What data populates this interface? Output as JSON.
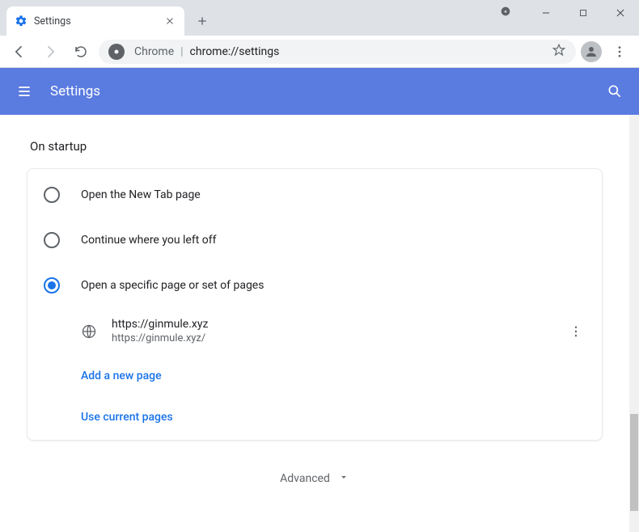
{
  "window": {
    "tab_title": "Settings",
    "url_prefix": "Chrome",
    "url_path": "chrome://settings"
  },
  "header": {
    "title": "Settings"
  },
  "startup": {
    "section_title": "On startup",
    "options": [
      {
        "label": "Open the New Tab page",
        "selected": false
      },
      {
        "label": "Continue where you left off",
        "selected": false
      },
      {
        "label": "Open a specific page or set of pages",
        "selected": true
      }
    ],
    "pages": [
      {
        "title": "https://ginmule.xyz",
        "url": "https://ginmule.xyz/"
      }
    ],
    "add_page_label": "Add a new page",
    "use_current_label": "Use current pages"
  },
  "advanced_label": "Advanced"
}
